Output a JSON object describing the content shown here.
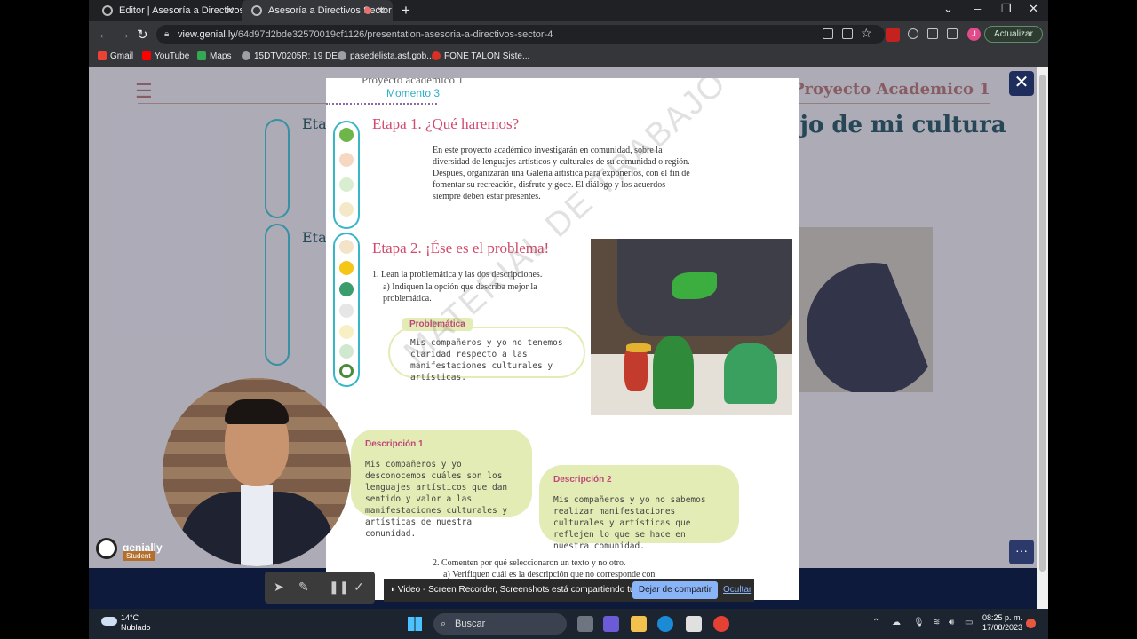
{
  "browser": {
    "tabs": [
      {
        "label": "Editor | Asesoría a Directivos Sect"
      },
      {
        "label": "Asesoría a Directivos Sector"
      }
    ],
    "url_host": "view.genial.ly",
    "url_path": "/64d97d2bde32570019cf1126/presentation-asesoria-a-directivos-sector-4",
    "update_label": "Actualizar",
    "profile_initial": "J",
    "bookmarks": [
      {
        "label": "Gmail",
        "color": "#ea4335"
      },
      {
        "label": "YouTube",
        "color": "#ff0000"
      },
      {
        "label": "Maps",
        "color": "#34a853"
      },
      {
        "label": "15DTV0205R: 19 DE...",
        "color": "#9aa0a6"
      },
      {
        "label": "pasedelista.asf.gob....",
        "color": "#9aa0a6"
      },
      {
        "label": "FONE TALON Siste...",
        "color": "#d93025"
      }
    ]
  },
  "background_slide": {
    "heading": "Proyecto Academico 1",
    "subheading": "ejo de mi cultura",
    "stage1_fragment": "Etapa",
    "stage2_fragment": "Etap",
    "brand": "genially",
    "brand_badge": "Student"
  },
  "document": {
    "top_text": "Proyecto académico 1",
    "momento": "Momento 3",
    "etapa1_title": "Etapa 1. ¿Qué haremos?",
    "etapa1_text": "En este proyecto académico investigarán en comunidad, sobre la diversidad de lenguajes artísticos y culturales de su comunidad o región. Después, organizarán una Galería artística para exponerlos, con el fin de fomentar su recreación, disfrute y goce. El diálogo y los acuerdos siempre deben estar presentes.",
    "etapa2_title": "Etapa 2. ¡Ése es el problema!",
    "item1": "1.  Lean la problemática y las dos descripciones.",
    "item1a": "a) Indiquen la opción que describa mejor la problemática.",
    "problematica_label": "Problemática",
    "problematica_text": "Mis compañeros y yo no tenemos claridad respecto a las manifestaciones culturales y artísticas.",
    "desc1_label": "Descripción 1",
    "desc1_text": "Mis compañeros y yo desconocemos cuáles son los lenguajes artísticos que dan sentido y valor a las manifestaciones culturales y artísticas de nuestra comunidad.",
    "desc2_label": "Descripción 2",
    "desc2_text": "Mis compañeros y yo no sabemos realizar manifestaciones culturales y artísticas que reflejen lo que se hace en nuestra comunidad.",
    "item2": "2.  Comenten por qué seleccionaron un texto y no otro.",
    "item2a": "a) Verifiquen cuál es la descripción que no corresponde con",
    "watermark": "MATERIAL DE TRABAJO"
  },
  "screen_share": {
    "message": "Video - Screen Recorder, Screenshots está compartiendo tu pantalla.",
    "stop_label": "Dejar de compartir",
    "hide_label": "Ocultar"
  },
  "taskbar": {
    "temperature": "14°C",
    "weather": "Nublado",
    "search_label": "Buscar",
    "time": "08:25 p. m.",
    "date": "17/08/2023"
  }
}
